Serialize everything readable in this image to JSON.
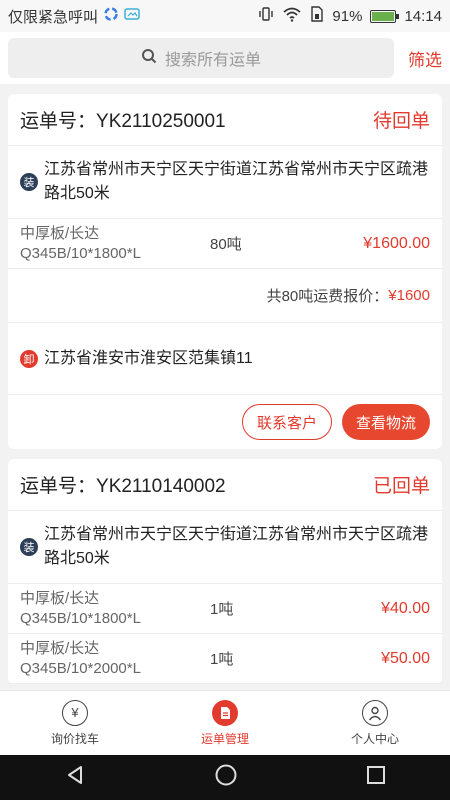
{
  "status_bar": {
    "notice": "仅限紧急呼叫",
    "battery": "91%",
    "time": "14:14"
  },
  "search": {
    "placeholder": "搜索所有运单",
    "filter_label": "筛选"
  },
  "orders": [
    {
      "order_label": "运单号：",
      "order_no": "YK2110250001",
      "status": "待回单",
      "load_tag": "装",
      "load_address": "江苏省常州市天宁区天宁街道江苏省常州市天宁区疏港路北50米",
      "goods": [
        {
          "name": "中厚板/长达",
          "spec": "Q345B/10*1800*L",
          "qty": "80吨",
          "price": "¥1600.00"
        }
      ],
      "total_prefix": "共80吨运费报价：",
      "total_amount": "¥1600",
      "unload_tag": "卸",
      "unload_address": "江苏省淮安市淮安区范集镇11",
      "contact_label": "联系客户",
      "logistics_label": "查看物流"
    },
    {
      "order_label": "运单号：",
      "order_no": "YK2110140002",
      "status": "已回单",
      "load_tag": "装",
      "load_address": "江苏省常州市天宁区天宁街道江苏省常州市天宁区疏港路北50米",
      "goods": [
        {
          "name": "中厚板/长达",
          "spec": "Q345B/10*1800*L",
          "qty": "1吨",
          "price": "¥40.00"
        },
        {
          "name": "中厚板/长达",
          "spec": "Q345B/10*2000*L",
          "qty": "1吨",
          "price": "¥50.00"
        }
      ]
    }
  ],
  "tabs": [
    {
      "label": "询价找车",
      "icon": "yen-icon"
    },
    {
      "label": "运单管理",
      "icon": "document-icon",
      "active": true
    },
    {
      "label": "个人中心",
      "icon": "person-icon"
    }
  ],
  "colors": {
    "accent": "#e23b2e",
    "load_tag": "#2c3e58"
  }
}
